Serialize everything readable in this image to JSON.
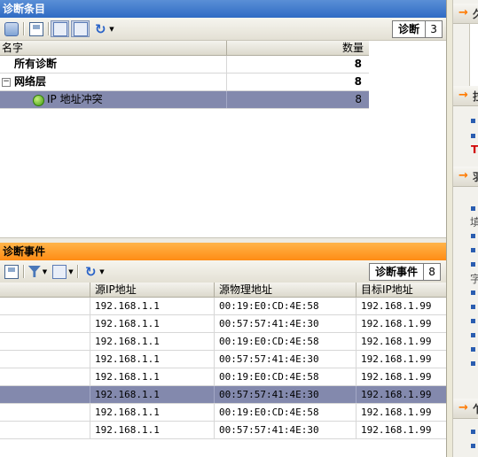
{
  "top_pane": {
    "title": "诊断条目",
    "counter_label": "诊断",
    "counter_value": "3",
    "columns": {
      "name": "名字",
      "count": "数量"
    },
    "rows": [
      {
        "name": "所有诊断",
        "count": "8"
      },
      {
        "name": "网络层",
        "count": "8",
        "expander": "−"
      },
      {
        "name": "IP 地址冲突",
        "count": "8"
      }
    ]
  },
  "bottom_pane": {
    "title": "诊断事件",
    "counter_label": "诊断事件",
    "counter_value": "8",
    "columns": {
      "src_ip": "源IP地址",
      "src_mac": "源物理地址",
      "dst_ip": "目标IP地址"
    },
    "rows": [
      {
        "src_ip": "192.168.1.1",
        "src_mac": "00:19:E0:CD:4E:58",
        "dst_ip": "192.168.1.99"
      },
      {
        "src_ip": "192.168.1.1",
        "src_mac": "00:57:57:41:4E:30",
        "dst_ip": "192.168.1.99"
      },
      {
        "src_ip": "192.168.1.1",
        "src_mac": "00:19:E0:CD:4E:58",
        "dst_ip": "192.168.1.99"
      },
      {
        "src_ip": "192.168.1.1",
        "src_mac": "00:57:57:41:4E:30",
        "dst_ip": "192.168.1.99"
      },
      {
        "src_ip": "192.168.1.1",
        "src_mac": "00:19:E0:CD:4E:58",
        "dst_ip": "192.168.1.99"
      },
      {
        "src_ip": "192.168.1.1",
        "src_mac": "00:57:57:41:4E:30",
        "dst_ip": "192.168.1.99"
      },
      {
        "src_ip": "192.168.1.1",
        "src_mac": "00:19:E0:CD:4E:58",
        "dst_ip": "192.168.1.99"
      },
      {
        "src_ip": "192.168.1.1",
        "src_mac": "00:57:57:41:4E:30",
        "dst_ip": "192.168.1.99"
      }
    ]
  },
  "side_panel": {
    "arrow": "→",
    "sections": [
      {
        "peek": "久"
      },
      {
        "peek": "拉",
        "red": "T"
      },
      {
        "peek": "羽",
        "texts": [
          "填",
          "字"
        ]
      },
      {
        "peek": "乍"
      }
    ]
  },
  "colors": {
    "title_blue": "#2f6bc4",
    "title_orange": "#ff8c14",
    "selection": "#8389ad",
    "arrow_orange": "#ff7a00"
  }
}
